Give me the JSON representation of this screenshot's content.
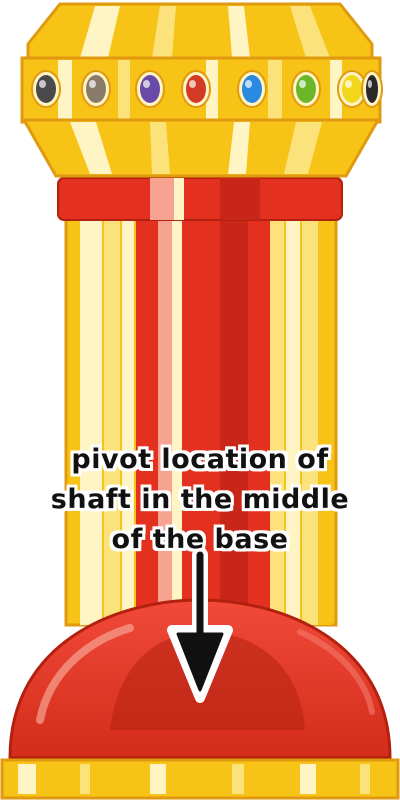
{
  "annotation": {
    "lines": [
      "pivot location of",
      "shaft in the middle",
      "of the base"
    ]
  },
  "jewels": [
    {
      "name": "gem-dark-grey",
      "color": "#4a4a4a"
    },
    {
      "name": "gem-taupe",
      "color": "#8a7a6a"
    },
    {
      "name": "gem-purple",
      "color": "#6a4aa8"
    },
    {
      "name": "gem-red",
      "color": "#d23a26"
    },
    {
      "name": "gem-blue",
      "color": "#2a8ae0"
    },
    {
      "name": "gem-green",
      "color": "#6ab82a"
    },
    {
      "name": "gem-yellow",
      "color": "#f2d61a"
    },
    {
      "name": "gem-black",
      "color": "#2a2a2a"
    }
  ],
  "colors": {
    "gold": "#f7c316",
    "gold_light": "#fbe27a",
    "cream": "#fff4c4",
    "red": "#e4311f",
    "red_dark": "#b3200f",
    "pink": "#f7a392",
    "outline": "#e09a10"
  }
}
